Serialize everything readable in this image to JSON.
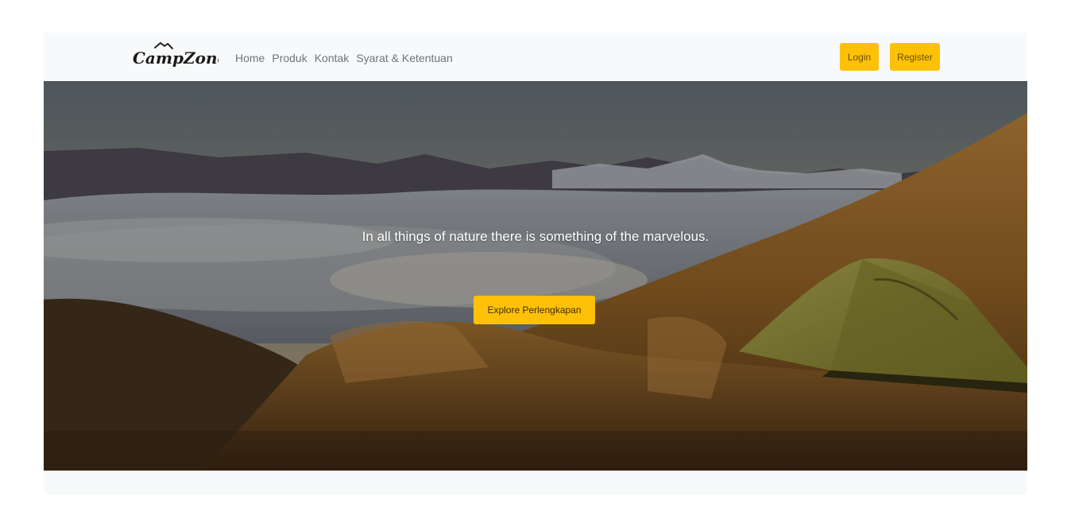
{
  "brand": {
    "name": "CampZone"
  },
  "nav": {
    "links": [
      {
        "label": "Home"
      },
      {
        "label": "Produk"
      },
      {
        "label": "Kontak"
      },
      {
        "label": "Syarat & Ketentuan"
      }
    ]
  },
  "auth": {
    "login_label": "Login",
    "register_label": "Register"
  },
  "hero": {
    "tagline": "In all things of nature there is something of the marvelous.",
    "cta_label": "Explore Perlengkapan"
  },
  "colors": {
    "accent": "#ffc107",
    "navbar_bg": "#f8f9fa",
    "link": "#6c757d"
  }
}
